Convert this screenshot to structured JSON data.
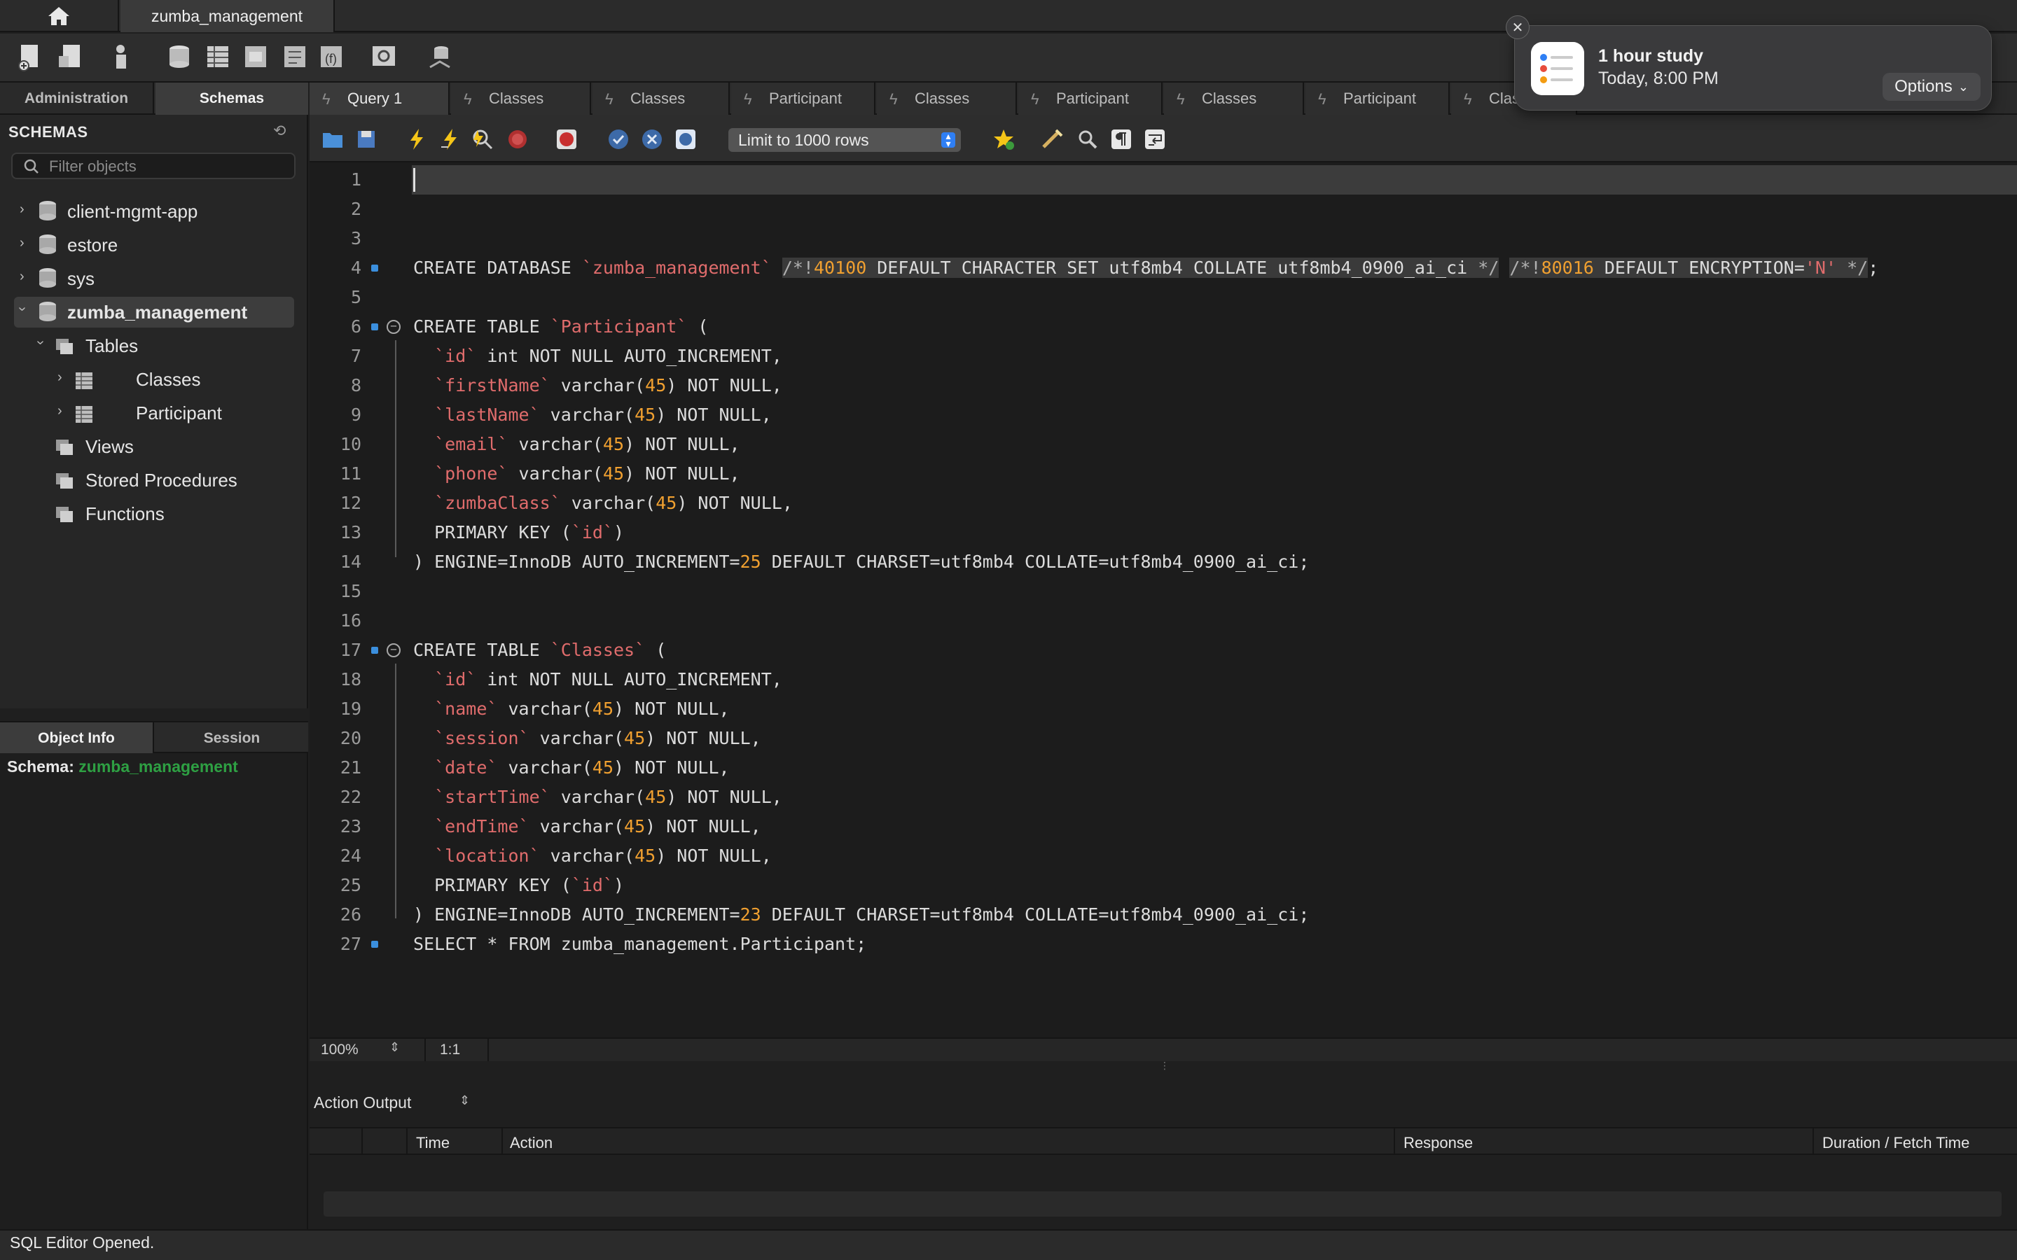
{
  "window": {
    "connection_tab": "zumba_management"
  },
  "sidebar": {
    "tabs": [
      "Administration",
      "Schemas"
    ],
    "title": "SCHEMAS",
    "filter_placeholder": "Filter objects",
    "tree": {
      "db1": "client-mgmt-app",
      "db2": "estore",
      "db3": "sys",
      "db4": "zumba_management",
      "tables": "Tables",
      "t1": "Classes",
      "t2": "Participant",
      "views": "Views",
      "procs": "Stored Procedures",
      "funcs": "Functions"
    },
    "info_tabs": [
      "Object Info",
      "Session"
    ],
    "schema_label": "Schema:",
    "schema_value": "zumba_management"
  },
  "editor_tabs": [
    "Query 1",
    "Classes",
    "Classes",
    "Participant",
    "Classes",
    "Participant",
    "Classes",
    "Participant",
    "Clas"
  ],
  "sql_toolbar": {
    "limit": "Limit to 1000 rows"
  },
  "editor": {
    "line_numbers": [
      "1",
      "2",
      "3",
      "4",
      "5",
      "6",
      "7",
      "8",
      "9",
      "10",
      "11",
      "12",
      "13",
      "14",
      "15",
      "16",
      "17",
      "18",
      "19",
      "20",
      "21",
      "22",
      "23",
      "24",
      "25",
      "26",
      "27"
    ]
  },
  "status_strip": {
    "zoom": "100%",
    "position": "1:1"
  },
  "output": {
    "selector": "Action Output",
    "columns": [
      "Time",
      "Action",
      "Response",
      "Duration / Fetch Time"
    ]
  },
  "statusbar": {
    "text": "SQL Editor Opened."
  },
  "notification": {
    "title": "1 hour study",
    "subtitle": "Today, 8:00 PM",
    "options": "Options"
  },
  "colors": {
    "keyword": "#dcdcdc",
    "identifier": "#e06c6c",
    "number": "#f0a030",
    "schema_value": "#2ea043",
    "marker": "#3b8fdd"
  }
}
